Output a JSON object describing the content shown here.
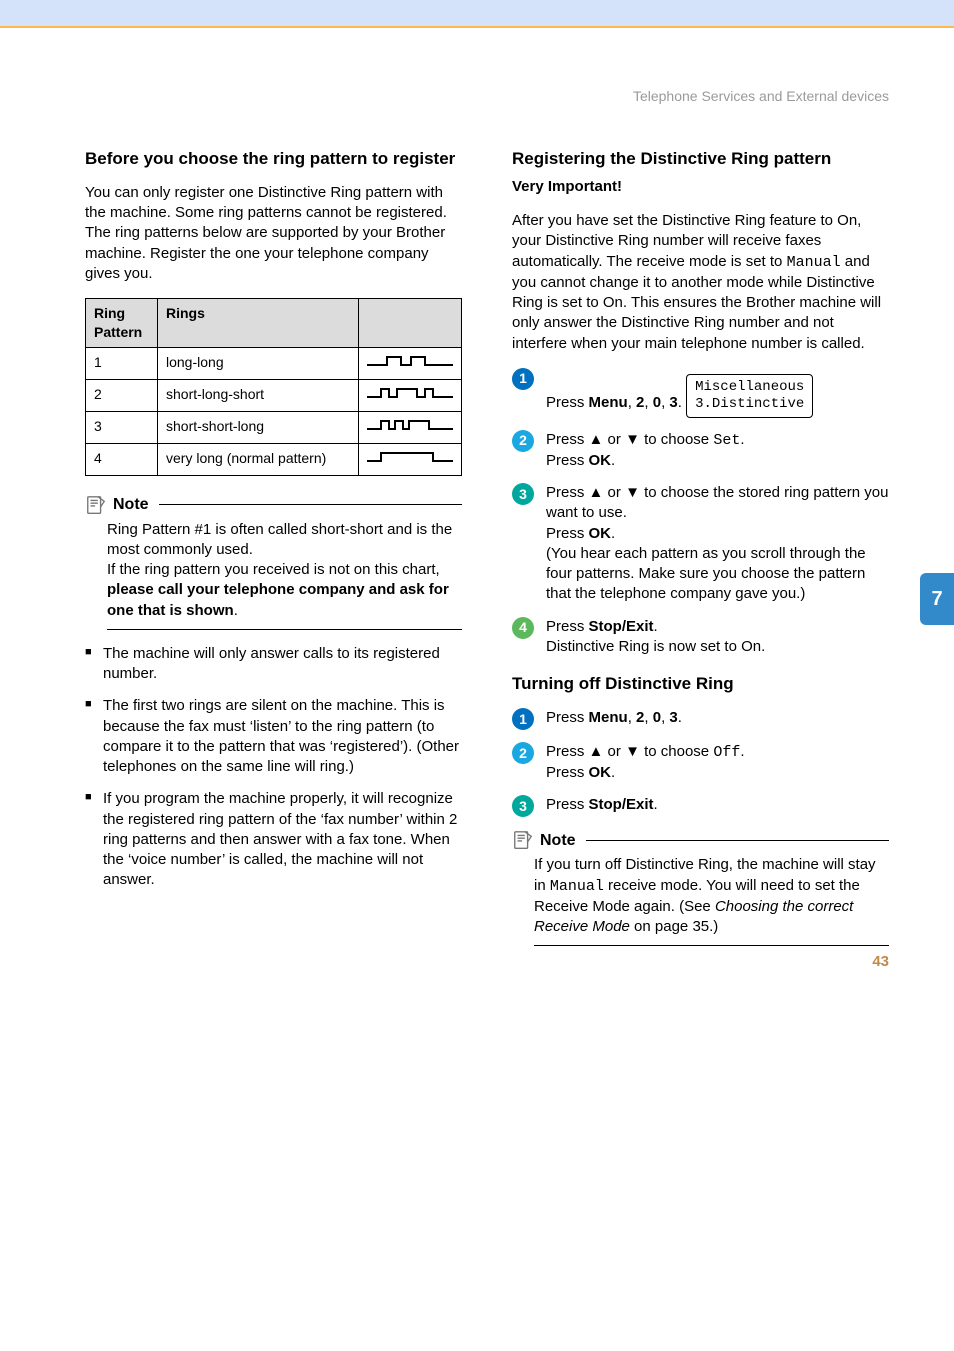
{
  "section_label": "Telephone Services and External devices",
  "side_tab": "7",
  "page_number": "43",
  "left": {
    "heading": "Before you choose the ring pattern to register",
    "intro": "You can only register one Distinctive Ring pattern with the machine. Some ring patterns cannot be registered. The ring patterns below are supported by your Brother machine. Register the one your telephone company gives you.",
    "table": {
      "headers": [
        "Ring Pattern",
        "Rings",
        ""
      ],
      "rows": [
        {
          "num": "1",
          "rings": "long-long"
        },
        {
          "num": "2",
          "rings": "short-long-short"
        },
        {
          "num": "3",
          "rings": "short-short-long"
        },
        {
          "num": "4",
          "rings": "very long (normal pattern)"
        }
      ]
    },
    "note_title": "Note",
    "note_body_1": "Ring Pattern #1 is often called short-short and is the most commonly used.",
    "note_body_2a": "If the ring pattern you received is not on this chart, ",
    "note_body_2b": "please call your telephone company and ask for one that is shown",
    "note_body_2c": ".",
    "bullets": [
      "The machine will only answer calls to its registered number.",
      "The first two rings are silent on the machine. This is because the fax must ‘listen’ to the ring pattern (to compare it to the pattern that was ‘registered’). (Other telephones on the same line will ring.)",
      "If you program the machine properly, it will recognize the registered ring pattern of the ‘fax number’ within 2 ring patterns and then answer with a fax tone. When the ‘voice number’ is called, the machine will not answer."
    ]
  },
  "right": {
    "reg_heading": "Registering the Distinctive Ring pattern",
    "very_important": "Very Important!",
    "reg_intro_a": "After you have set the Distinctive Ring feature to On, your Distinctive Ring number will receive faxes automatically. The receive mode is set to ",
    "reg_intro_mono": "Manual",
    "reg_intro_b": " and you cannot change it to another mode while Distinctive Ring is set to On. This ensures the Brother machine will only answer the Distinctive Ring number and not interfere when your main telephone number is called.",
    "step1_a": "Press ",
    "step1_menu": "Menu",
    "step1_b": ", ",
    "step1_k1": "2",
    "step1_k2": "0",
    "step1_k3": "3",
    "step1_dot": ".",
    "lcd_line1": "Miscellaneous",
    "lcd_line2": "3.Distinctive",
    "step2_a": "Press ",
    "step2_up": "▲",
    "step2_or": " or ",
    "step2_down": "▼",
    "step2_b": " to choose ",
    "step2_mono": "Set",
    "step2_c": ".",
    "step2_d": "Press ",
    "step2_ok": "OK",
    "step2_e": ".",
    "step3_a": "Press ",
    "step3_b": " to choose the stored ring pattern you want to use.",
    "step3_c": "Press ",
    "step3_d": "(You hear each pattern as you scroll through the four patterns. Make sure you choose the pattern that the telephone company gave you.)",
    "step4_a": "Press ",
    "step4_stop": "Stop/Exit",
    "step4_b": ".",
    "step4_c": "Distinctive Ring is now set to On.",
    "off_heading": "Turning off Distinctive Ring",
    "off_step2_mono": "Off",
    "note2_a": "If you turn off Distinctive Ring, the machine will stay in ",
    "note2_mono": "Manual",
    "note2_b": " receive mode. You will need to set the Receive Mode again. (See ",
    "note2_italic": "Choosing the correct Receive Mode",
    "note2_c": " on page 35.)"
  }
}
